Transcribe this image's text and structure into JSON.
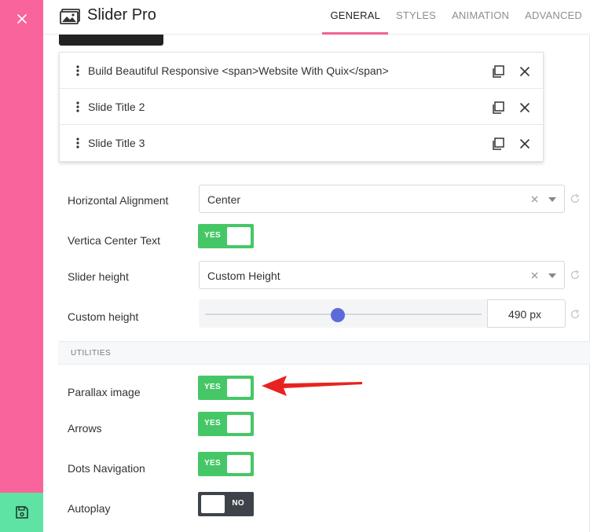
{
  "header": {
    "title": "Slider Pro",
    "tabs": [
      {
        "label": "GENERAL",
        "active": true
      },
      {
        "label": "STYLES",
        "active": false
      },
      {
        "label": "ANIMATION",
        "active": false
      },
      {
        "label": "ADVANCED",
        "active": false
      }
    ]
  },
  "slides": [
    {
      "title": "Build Beautiful Responsive <span>Website With Quix</span>"
    },
    {
      "title": "Slide Title 2"
    },
    {
      "title": "Slide Title 3"
    }
  ],
  "settings": {
    "horizontal_alignment": {
      "label": "Horizontal Alignment",
      "value": "Center"
    },
    "vertical_center": {
      "label": "Vertica Center Text",
      "state": "YES"
    },
    "slider_height": {
      "label": "Slider height",
      "value": "Custom Height"
    },
    "custom_height": {
      "label": "Custom height",
      "value": "490 px",
      "level": 0.48
    }
  },
  "utilities": {
    "heading": "UTILITIES",
    "parallax": {
      "label": "Parallax image",
      "state": "YES"
    },
    "arrows": {
      "label": "Arrows",
      "state": "YES"
    },
    "dots": {
      "label": "Dots Navigation",
      "state": "YES"
    },
    "autoplay": {
      "label": "Autoplay",
      "state": "NO"
    }
  },
  "colors": {
    "sidebar": "#f8649b",
    "save": "#5ee3a4",
    "toggle_on": "#46c767",
    "toggle_off": "#3d4349",
    "tab_underline": "#f0648e",
    "slider_thumb": "#5d6ad9",
    "annotation_arrow": "#e8231f"
  },
  "icons": {
    "close": "close-icon",
    "save": "floppy-disk-icon",
    "logo": "image-icon",
    "drag": "vertical-dots-icon",
    "duplicate": "copy-icon",
    "remove": "close-icon",
    "reset": "refresh-icon",
    "clear": "clear-x-icon"
  }
}
